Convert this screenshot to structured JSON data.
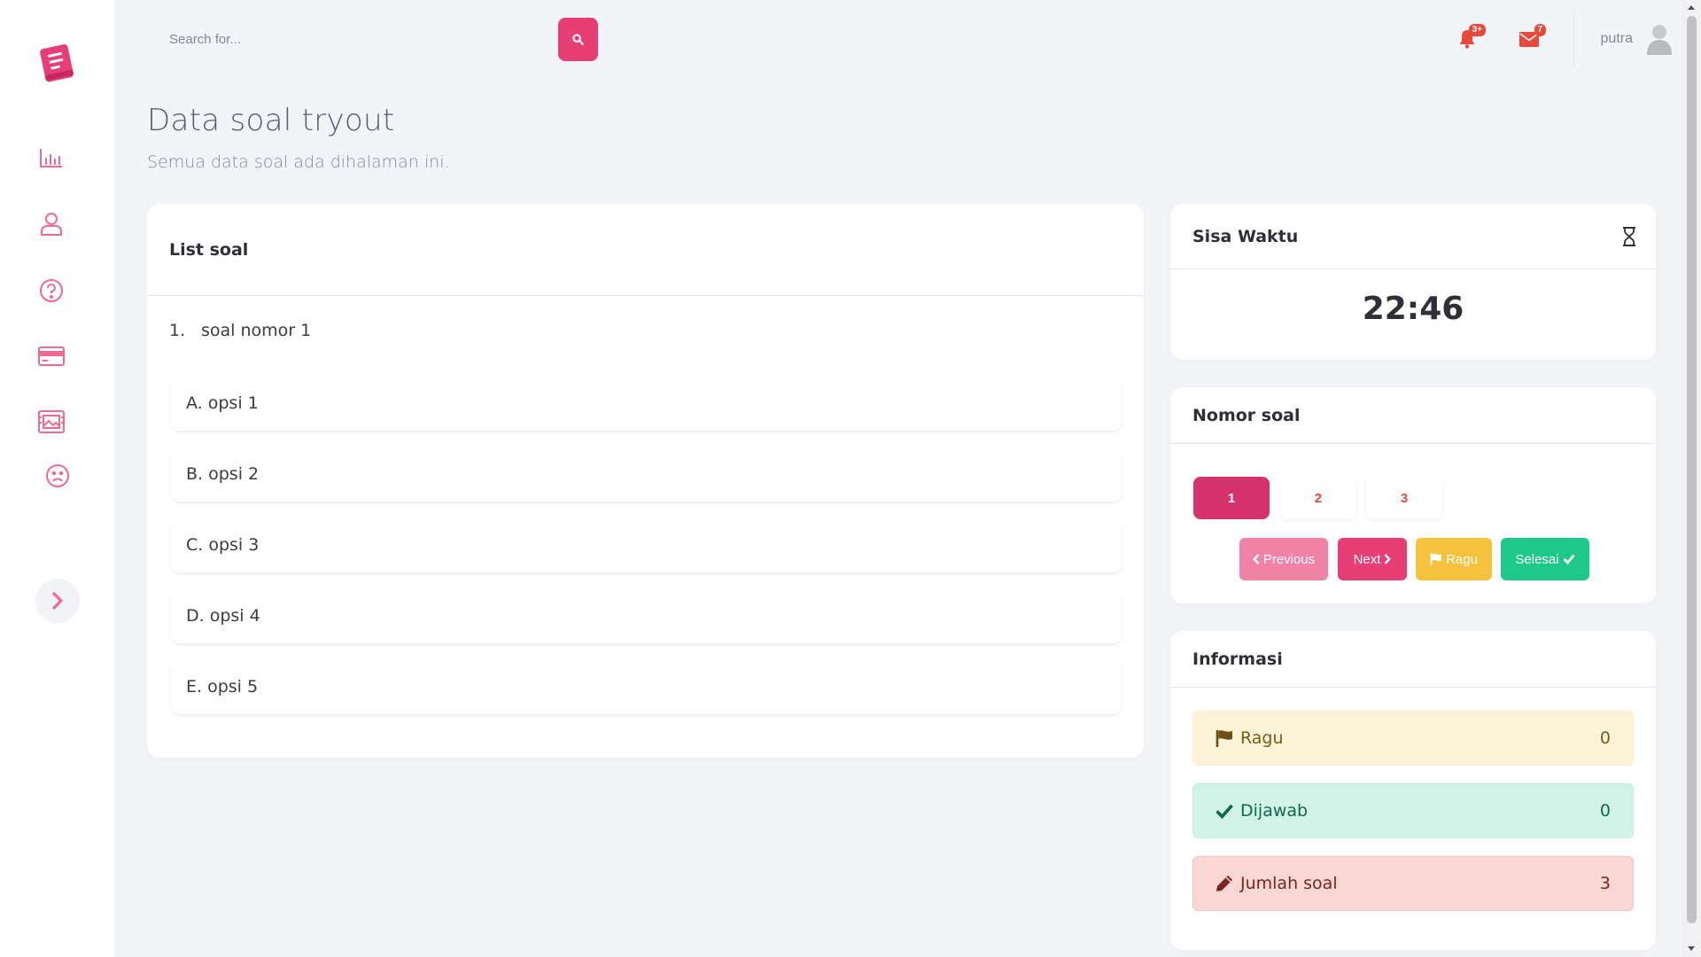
{
  "sidebar": {
    "brand_icon": "book-icon",
    "items": [
      {
        "icon": "chart-bar-icon"
      },
      {
        "icon": "user-icon"
      },
      {
        "icon": "question-circle-icon"
      },
      {
        "icon": "credit-card-icon"
      },
      {
        "icon": "images-icon"
      },
      {
        "icon": "frown-icon"
      }
    ],
    "toggle_icon": "chevron-right-icon",
    "accent": "#e83e76"
  },
  "topbar": {
    "search_placeholder": "Search for...",
    "search_icon": "search-icon",
    "alerts_badge": "3+",
    "messages_badge": "7",
    "username": "putra"
  },
  "page": {
    "title": "Data soal tryout",
    "subtitle": "Semua data soal ada dihalaman ini."
  },
  "list_soal": {
    "header": "List soal",
    "question_number": "1.",
    "question_text": "soal nomor 1",
    "options": [
      "A. opsi 1",
      "B. opsi 2",
      "C. opsi 3",
      "D. opsi 4",
      "E. opsi 5"
    ]
  },
  "timer": {
    "header": "Sisa Waktu",
    "icon": "hourglass-icon",
    "value": "22:46"
  },
  "nomor_soal": {
    "header": "Nomor soal",
    "numbers": [
      "1",
      "2",
      "3"
    ],
    "active": "1",
    "buttons": {
      "previous": "Previous",
      "next": "Next",
      "ragu": "Ragu",
      "selesai": "Selesai"
    },
    "colors": {
      "active_number": "#d6336c",
      "previous": "#f082a6",
      "next": "#e83e76",
      "ragu": "#f6c23e",
      "selesai": "#1cc88a"
    }
  },
  "informasi": {
    "header": "Informasi",
    "rows": [
      {
        "label": "Ragu",
        "value": "0",
        "icon": "flag-icon"
      },
      {
        "label": "Dijawab",
        "value": "0",
        "icon": "check-icon"
      },
      {
        "label": "Jumlah soal",
        "value": "3",
        "icon": "pencil-icon"
      }
    ]
  }
}
